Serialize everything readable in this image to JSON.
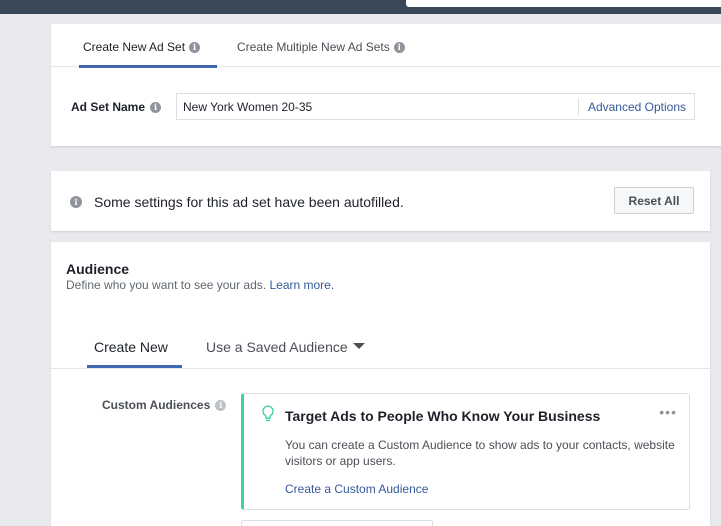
{
  "adset": {
    "tabs": [
      {
        "label": "Create New Ad Set"
      },
      {
        "label": "Create Multiple New Ad Sets"
      }
    ],
    "name_label": "Ad Set Name",
    "name_value": "New York Women 20-35",
    "advanced_options": "Advanced Options"
  },
  "autofill": {
    "message": "Some settings for this ad set have been autofilled.",
    "reset_label": "Reset All"
  },
  "audience": {
    "title": "Audience",
    "subtitle": "Define who you want to see your ads.",
    "learn_more": "Learn more.",
    "tabs": [
      {
        "label": "Create New"
      },
      {
        "label": "Use a Saved Audience"
      }
    ],
    "custom_audiences_label": "Custom Audiences",
    "tip": {
      "title": "Target Ads to People Who Know Your Business",
      "body": "You can create a Custom Audience to show ads to your contacts, website visitors or app users.",
      "link": "Create a Custom Audience",
      "menu_icon": "more-dots-icon"
    }
  },
  "colors": {
    "accent": "#4267b2",
    "link": "#365899",
    "tip_border": "#3cd1a6",
    "background": "#e9eaed"
  }
}
